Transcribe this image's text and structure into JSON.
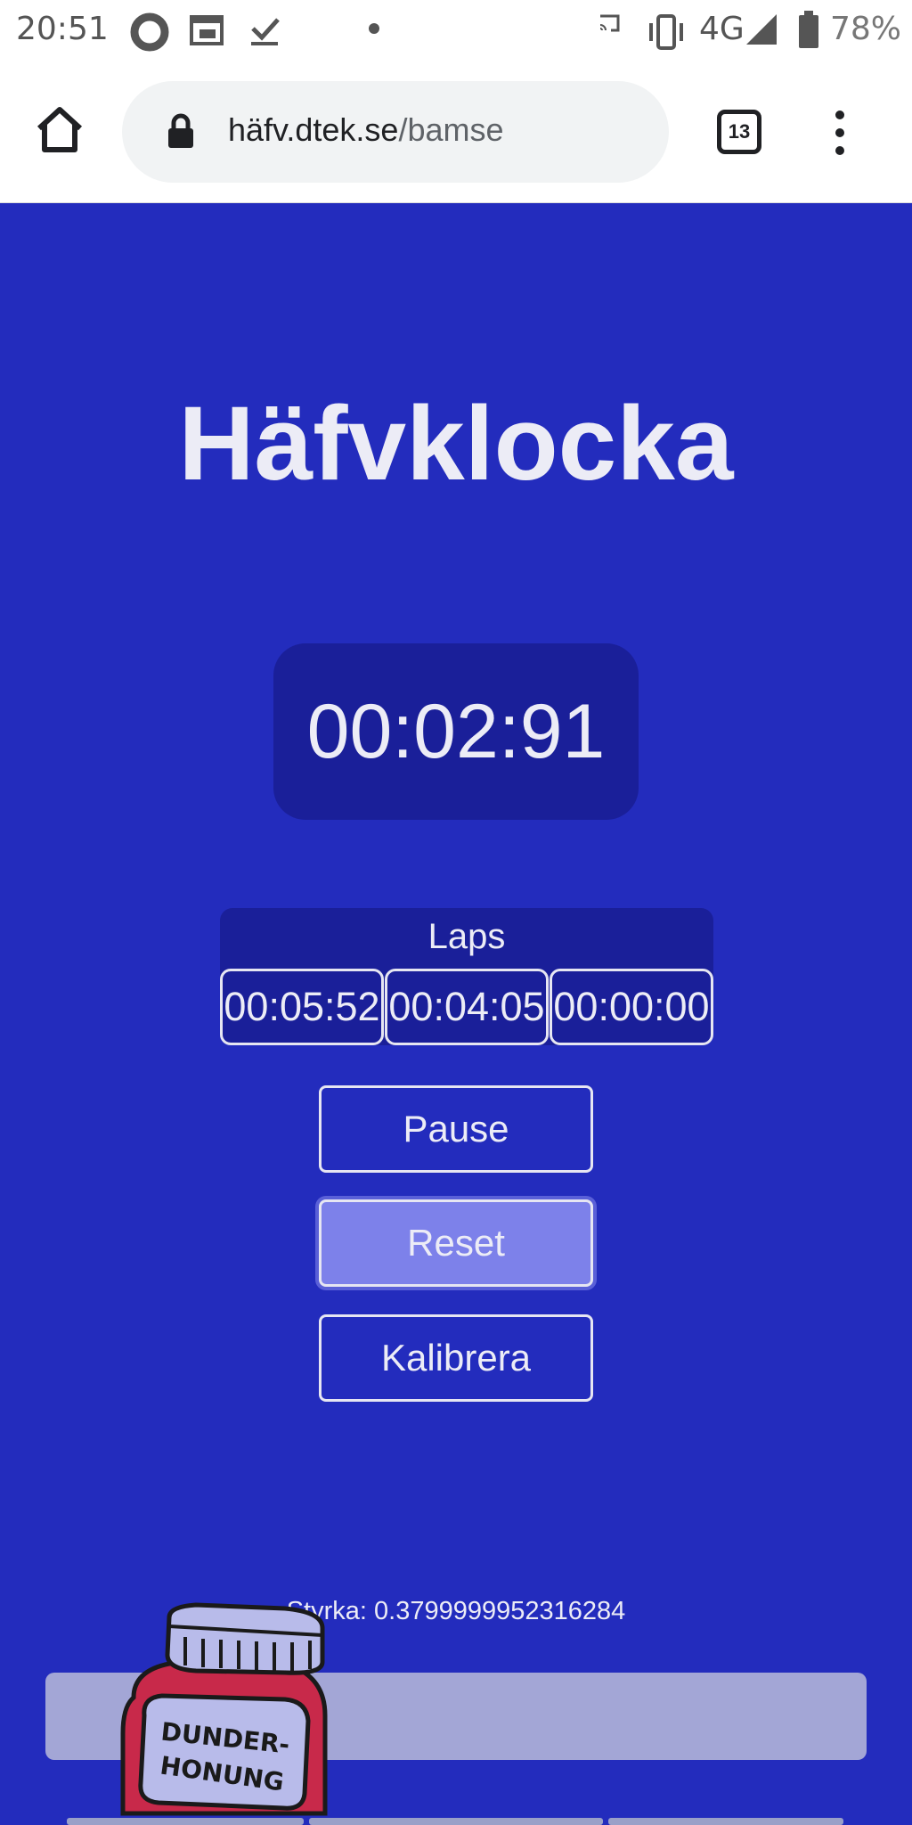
{
  "status_bar": {
    "time": "20:51",
    "network": "4G",
    "battery": "78%"
  },
  "browser": {
    "url_host": "häfv.dtek.se",
    "url_path": "/bamse",
    "tab_count": "13"
  },
  "page": {
    "title": "Häfvklocka",
    "timer": "00:02:91",
    "laps_title": "Laps",
    "laps": [
      "00:05:52",
      "00:04:05",
      "00:00:00"
    ],
    "buttons": {
      "pause": "Pause",
      "reset": "Reset",
      "calibrate": "Kalibrera"
    },
    "strength": "Styrka: 0.3799999952316284",
    "jar_label_line1": "DUNDER-",
    "jar_label_line2": "HONUNG"
  },
  "colors": {
    "background": "#232cbd",
    "panel": "#1a1f99",
    "active_button": "#7d81ea"
  }
}
